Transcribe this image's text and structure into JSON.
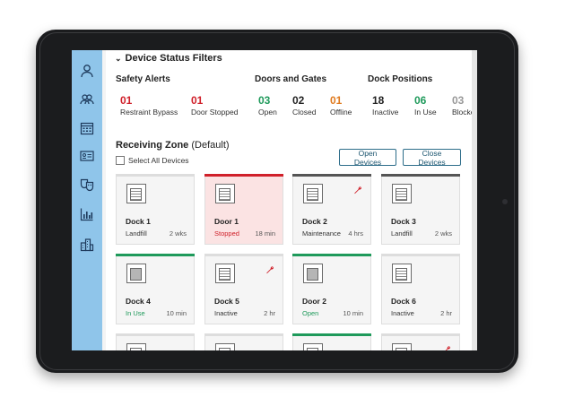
{
  "colors": {
    "sidebar": "#8fc5ea",
    "alert_red": "#d0202a",
    "ok_green": "#1f9a5b",
    "warn_orange": "#e07a1e",
    "neutral_gray": "#999999",
    "dark": "#222222",
    "button_border": "#2d6d8a"
  },
  "sidebar": {
    "icons": [
      "user-icon",
      "users-icon",
      "calendar-icon",
      "id-card-icon",
      "masks-icon",
      "bar-chart-icon",
      "buildings-icon"
    ]
  },
  "filters": {
    "title": "Device Status Filters",
    "groups": [
      {
        "title": "Safety Alerts",
        "stats": [
          {
            "count": "01",
            "label": "Restraint Bypass",
            "color": "#d0202a"
          },
          {
            "count": "01",
            "label": "Door Stopped",
            "color": "#d0202a"
          }
        ]
      },
      {
        "title": "Doors and Gates",
        "stats": [
          {
            "count": "03",
            "label": "Open",
            "color": "#1f9a5b"
          },
          {
            "count": "02",
            "label": "Closed",
            "color": "#222222"
          },
          {
            "count": "01",
            "label": "Offline",
            "color": "#e07a1e"
          }
        ]
      },
      {
        "title": "Dock Positions",
        "stats": [
          {
            "count": "18",
            "label": "Inactive",
            "color": "#222222"
          },
          {
            "count": "06",
            "label": "In Use",
            "color": "#1f9a5b"
          },
          {
            "count": "03",
            "label": "Blocked",
            "color": "#999999"
          }
        ]
      }
    ]
  },
  "zone": {
    "title": "Receiving Zone",
    "subtitle": "(Default)",
    "select_all_label": "Select All Devices",
    "open_button": "Open Devices",
    "close_button": "Close Devices"
  },
  "devices": [
    {
      "name": "Dock 1",
      "status": "Landfill",
      "time": "2 wks",
      "status_color": "#333333",
      "bar_color": "#dddddd",
      "background": "normal",
      "wrench": false,
      "door_closed": false
    },
    {
      "name": "Door 1",
      "status": "Stopped",
      "time": "18 min",
      "status_color": "#d0202a",
      "bar_color": "#d0202a",
      "background": "red",
      "wrench": false,
      "door_closed": false
    },
    {
      "name": "Dock 2",
      "status": "Maintenance",
      "time": "4 hrs",
      "status_color": "#333333",
      "bar_color": "#555555",
      "background": "normal",
      "wrench": true,
      "door_closed": false
    },
    {
      "name": "Dock 3",
      "status": "Landfill",
      "time": "2 wks",
      "status_color": "#333333",
      "bar_color": "#555555",
      "background": "normal",
      "wrench": false,
      "door_closed": false
    },
    {
      "name": "Dock 4",
      "status": "In Use",
      "time": "10 min",
      "status_color": "#1f9a5b",
      "bar_color": "#1f9a5b",
      "background": "normal",
      "wrench": false,
      "door_closed": true
    },
    {
      "name": "Dock 5",
      "status": "Inactive",
      "time": "2 hr",
      "status_color": "#333333",
      "bar_color": "#dddddd",
      "background": "normal",
      "wrench": true,
      "door_closed": false
    },
    {
      "name": "Door 2",
      "status": "Open",
      "time": "10 min",
      "status_color": "#1f9a5b",
      "bar_color": "#1f9a5b",
      "background": "normal",
      "wrench": false,
      "door_closed": true
    },
    {
      "name": "Dock 6",
      "status": "Inactive",
      "time": "2 hr",
      "status_color": "#333333",
      "bar_color": "#dddddd",
      "background": "normal",
      "wrench": false,
      "door_closed": false
    },
    {
      "name": "",
      "status": "",
      "time": "",
      "status_color": "#333333",
      "bar_color": "#dddddd",
      "background": "normal",
      "wrench": false,
      "door_closed": false
    },
    {
      "name": "",
      "status": "",
      "time": "",
      "status_color": "#333333",
      "bar_color": "#dddddd",
      "background": "normal",
      "wrench": false,
      "door_closed": false
    },
    {
      "name": "",
      "status": "",
      "time": "",
      "status_color": "#333333",
      "bar_color": "#1f9a5b",
      "background": "normal",
      "wrench": false,
      "door_closed": false
    },
    {
      "name": "",
      "status": "",
      "time": "",
      "status_color": "#333333",
      "bar_color": "#dddddd",
      "background": "normal",
      "wrench": true,
      "door_closed": false
    }
  ]
}
